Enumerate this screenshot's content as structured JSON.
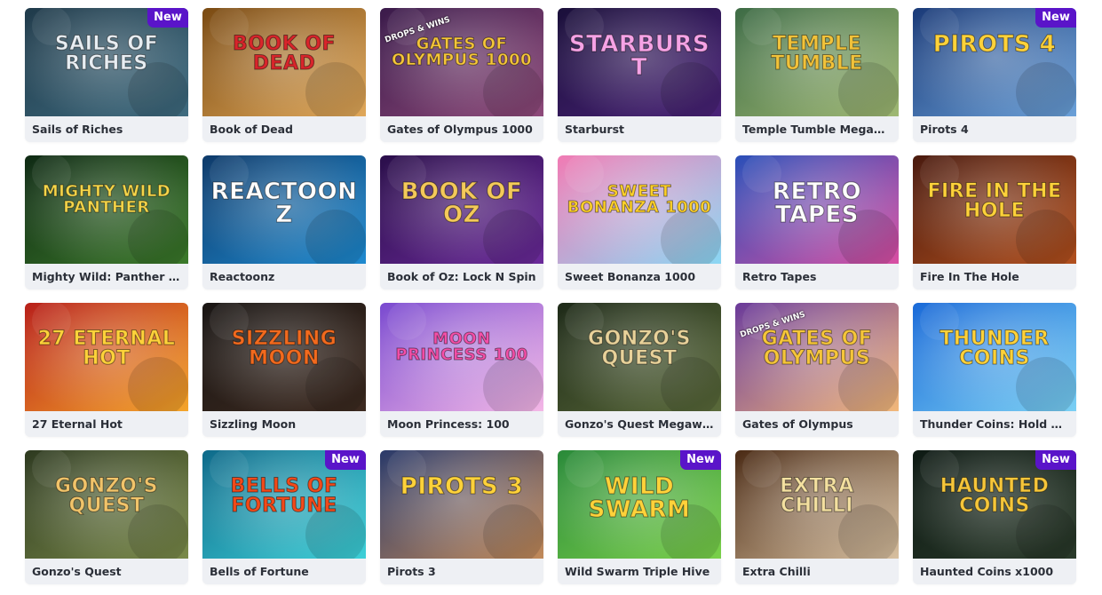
{
  "games": [
    {
      "title": "Sails of Riches",
      "art": "Sails of Riches",
      "badge": "New",
      "bg": [
        "#1f3a4a",
        "#3f6b7f"
      ],
      "fg": "#e8eef3",
      "icon": "ship-icon"
    },
    {
      "title": "Book of Dead",
      "art": "Book of Dead",
      "badge": "",
      "bg": [
        "#7a4a12",
        "#e0a85a"
      ],
      "fg": "#d8252b",
      "icon": "book-icon"
    },
    {
      "title": "Gates of Olympus 1000",
      "art": "Gates of Olympus 1000",
      "badge": "",
      "bg": [
        "#3a1a4a",
        "#8e4a7a"
      ],
      "fg": "#f6c63a",
      "icon": "temple-icon",
      "drops": "DROPS & WINS"
    },
    {
      "title": "Starburst",
      "art": "Starburst",
      "badge": "",
      "bg": [
        "#1a0f3a",
        "#4a2378"
      ],
      "fg": "#f6a3e6",
      "icon": "star-icon"
    },
    {
      "title": "Temple Tumble Megaways",
      "art": "Temple Tumble",
      "badge": "",
      "bg": [
        "#3d6b45",
        "#9fb873"
      ],
      "fg": "#f1c23a",
      "icon": "temple-icon"
    },
    {
      "title": "Pirots 4",
      "art": "Pirots 4",
      "badge": "New",
      "bg": [
        "#1a3a78",
        "#6aa0d8"
      ],
      "fg": "#ffd23a",
      "icon": "bird-icon"
    },
    {
      "title": "Mighty Wild: Panther Grand Diamond Edition",
      "art": "Mighty Wild Panther",
      "badge": "",
      "bg": [
        "#0f2a14",
        "#3b7a2a"
      ],
      "fg": "#f6d64a",
      "icon": "panther-icon"
    },
    {
      "title": "Reactoonz",
      "art": "Reactoonz",
      "badge": "",
      "bg": [
        "#0e3a6a",
        "#1e8ad0"
      ],
      "fg": "#ffffff",
      "icon": "alien-icon"
    },
    {
      "title": "Book of Oz: Lock N Spin",
      "art": "Book of Oz",
      "badge": "",
      "bg": [
        "#2a0e4a",
        "#6b2a9a"
      ],
      "fg": "#f4c95a",
      "icon": "book-icon"
    },
    {
      "title": "Sweet Bonanza 1000",
      "art": "Sweet Bonanza 1000",
      "badge": "",
      "bg": [
        "#f17bb4",
        "#8ad7f4"
      ],
      "fg": "#ffd12a",
      "icon": "candy-icon"
    },
    {
      "title": "Retro Tapes",
      "art": "Retro Tapes",
      "badge": "",
      "bg": [
        "#2a4fb8",
        "#d94fa2"
      ],
      "fg": "#ffffff",
      "icon": "tape-icon"
    },
    {
      "title": "Fire In The Hole",
      "art": "Fire In The Hole",
      "badge": "",
      "bg": [
        "#4a1a0e",
        "#b2501e"
      ],
      "fg": "#ffd23a",
      "icon": "miner-icon"
    },
    {
      "title": "27 Eternal Hot",
      "art": "27 Eternal Hot",
      "badge": "",
      "bg": [
        "#b8201a",
        "#f4a52a"
      ],
      "fg": "#ffd23a",
      "icon": "seven-icon"
    },
    {
      "title": "Sizzling Moon",
      "art": "Sizzling Moon",
      "badge": "",
      "bg": [
        "#1a1614",
        "#3d2a20"
      ],
      "fg": "#f26a1e",
      "icon": "moon-icon"
    },
    {
      "title": "Moon Princess: 100",
      "art": "Moon Princess 100",
      "badge": "",
      "bg": [
        "#7a4ad0",
        "#f4b7e6"
      ],
      "fg": "#f54fa8",
      "icon": "moon-icon"
    },
    {
      "title": "Gonzo's Quest Megaways",
      "art": "Gonzo's Quest",
      "badge": "",
      "bg": [
        "#1e2a18",
        "#5a6a3a"
      ],
      "fg": "#e8d29a",
      "icon": "explorer-icon"
    },
    {
      "title": "Gates of Olympus",
      "art": "Gates of Olympus",
      "badge": "",
      "bg": [
        "#6a3a9a",
        "#f2b87a"
      ],
      "fg": "#f6c63a",
      "icon": "zeus-icon",
      "drops": "DROPS & WINS"
    },
    {
      "title": "Thunder Coins: Hold and Win",
      "art": "Thunder Coins",
      "badge": "",
      "bg": [
        "#1a6ad8",
        "#7ad0f4"
      ],
      "fg": "#ffd23a",
      "icon": "coin-icon"
    },
    {
      "title": "Gonzo's Quest",
      "art": "Gonzo's Quest",
      "badge": "",
      "bg": [
        "#2e3a20",
        "#7a8a4a"
      ],
      "fg": "#f1c46a",
      "icon": "explorer-icon"
    },
    {
      "title": "Bells of Fortune",
      "art": "Bells of Fortune",
      "badge": "New",
      "bg": [
        "#0e6a8a",
        "#3ed0d8"
      ],
      "fg": "#f24a1a",
      "icon": "bell-icon"
    },
    {
      "title": "Pirots 3",
      "art": "Pirots 3",
      "badge": "",
      "bg": [
        "#2a3a6a",
        "#c28a5a"
      ],
      "fg": "#ffd23a",
      "icon": "bird-icon"
    },
    {
      "title": "Wild Swarm Triple Hive",
      "art": "Wild Swarm",
      "badge": "New",
      "bg": [
        "#2a8a3a",
        "#7ad04a"
      ],
      "fg": "#ffd23a",
      "icon": "bee-icon"
    },
    {
      "title": "Extra Chilli",
      "art": "Extra Chilli",
      "badge": "",
      "bg": [
        "#4a2a14",
        "#d8c0a0"
      ],
      "fg": "#f4e0a0",
      "icon": "chilli-icon"
    },
    {
      "title": "Haunted Coins x1000",
      "art": "Haunted Coins",
      "badge": "New",
      "bg": [
        "#0e1a14",
        "#2a3a2a"
      ],
      "fg": "#f6c63a",
      "icon": "pumpkin-icon"
    }
  ]
}
